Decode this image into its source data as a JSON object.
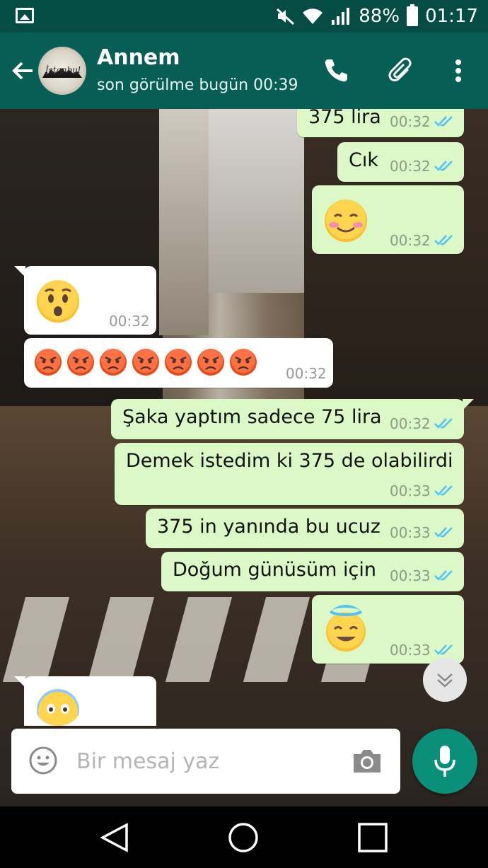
{
  "status_bar": {
    "battery": "88%",
    "time": "01:17",
    "icons": [
      "image-icon",
      "mute-icon",
      "wifi-icon",
      "signal-icon",
      "battery-icon"
    ]
  },
  "header": {
    "contact_name": "Annem",
    "last_seen": "son görülme bugün 00:39",
    "avatar_text": "İstanbul",
    "icons": [
      "back-arrow-icon",
      "phone-icon",
      "paperclip-icon",
      "more-vert-icon"
    ]
  },
  "messages": [
    {
      "dir": "out",
      "text": "375 lira",
      "time": "00:32",
      "read": true
    },
    {
      "dir": "out",
      "text": "Cık",
      "time": "00:32",
      "read": true
    },
    {
      "dir": "out",
      "emoji": "blushing-smile",
      "time": "00:32",
      "read": true
    },
    {
      "dir": "in",
      "emoji": "hushed-face",
      "time": "00:32"
    },
    {
      "dir": "in",
      "emoji": "angry-face x7",
      "time": "00:32"
    },
    {
      "dir": "out",
      "text": "Şaka yaptım sadece 75 lira",
      "time": "00:32",
      "read": true
    },
    {
      "dir": "out",
      "text": "Demek istedim ki 375 de olabilirdi",
      "time": "00:33",
      "read": true
    },
    {
      "dir": "out",
      "text": "375 in yanında bu ucuz",
      "time": "00:33",
      "read": true
    },
    {
      "dir": "out",
      "text": "Doğum günüsüm için",
      "time": "00:33",
      "read": true
    },
    {
      "dir": "out",
      "emoji": "halo-smile",
      "time": "00:33",
      "read": true
    },
    {
      "dir": "in",
      "emoji": "screaming-face",
      "time": ""
    }
  ],
  "input": {
    "placeholder": "Bir mesaj yaz",
    "icons": [
      "emoji-icon",
      "camera-icon",
      "mic-icon"
    ]
  },
  "colors": {
    "header": "#075e54",
    "status_bar": "#054d44",
    "outgoing_bubble": "#dcf8c6",
    "incoming_bubble": "#ffffff",
    "read_ticks": "#4fc3f7",
    "mic_button": "#0a8f7a"
  },
  "nav": {
    "icons": [
      "back-triangle-icon",
      "home-circle-icon",
      "recents-square-icon"
    ]
  }
}
